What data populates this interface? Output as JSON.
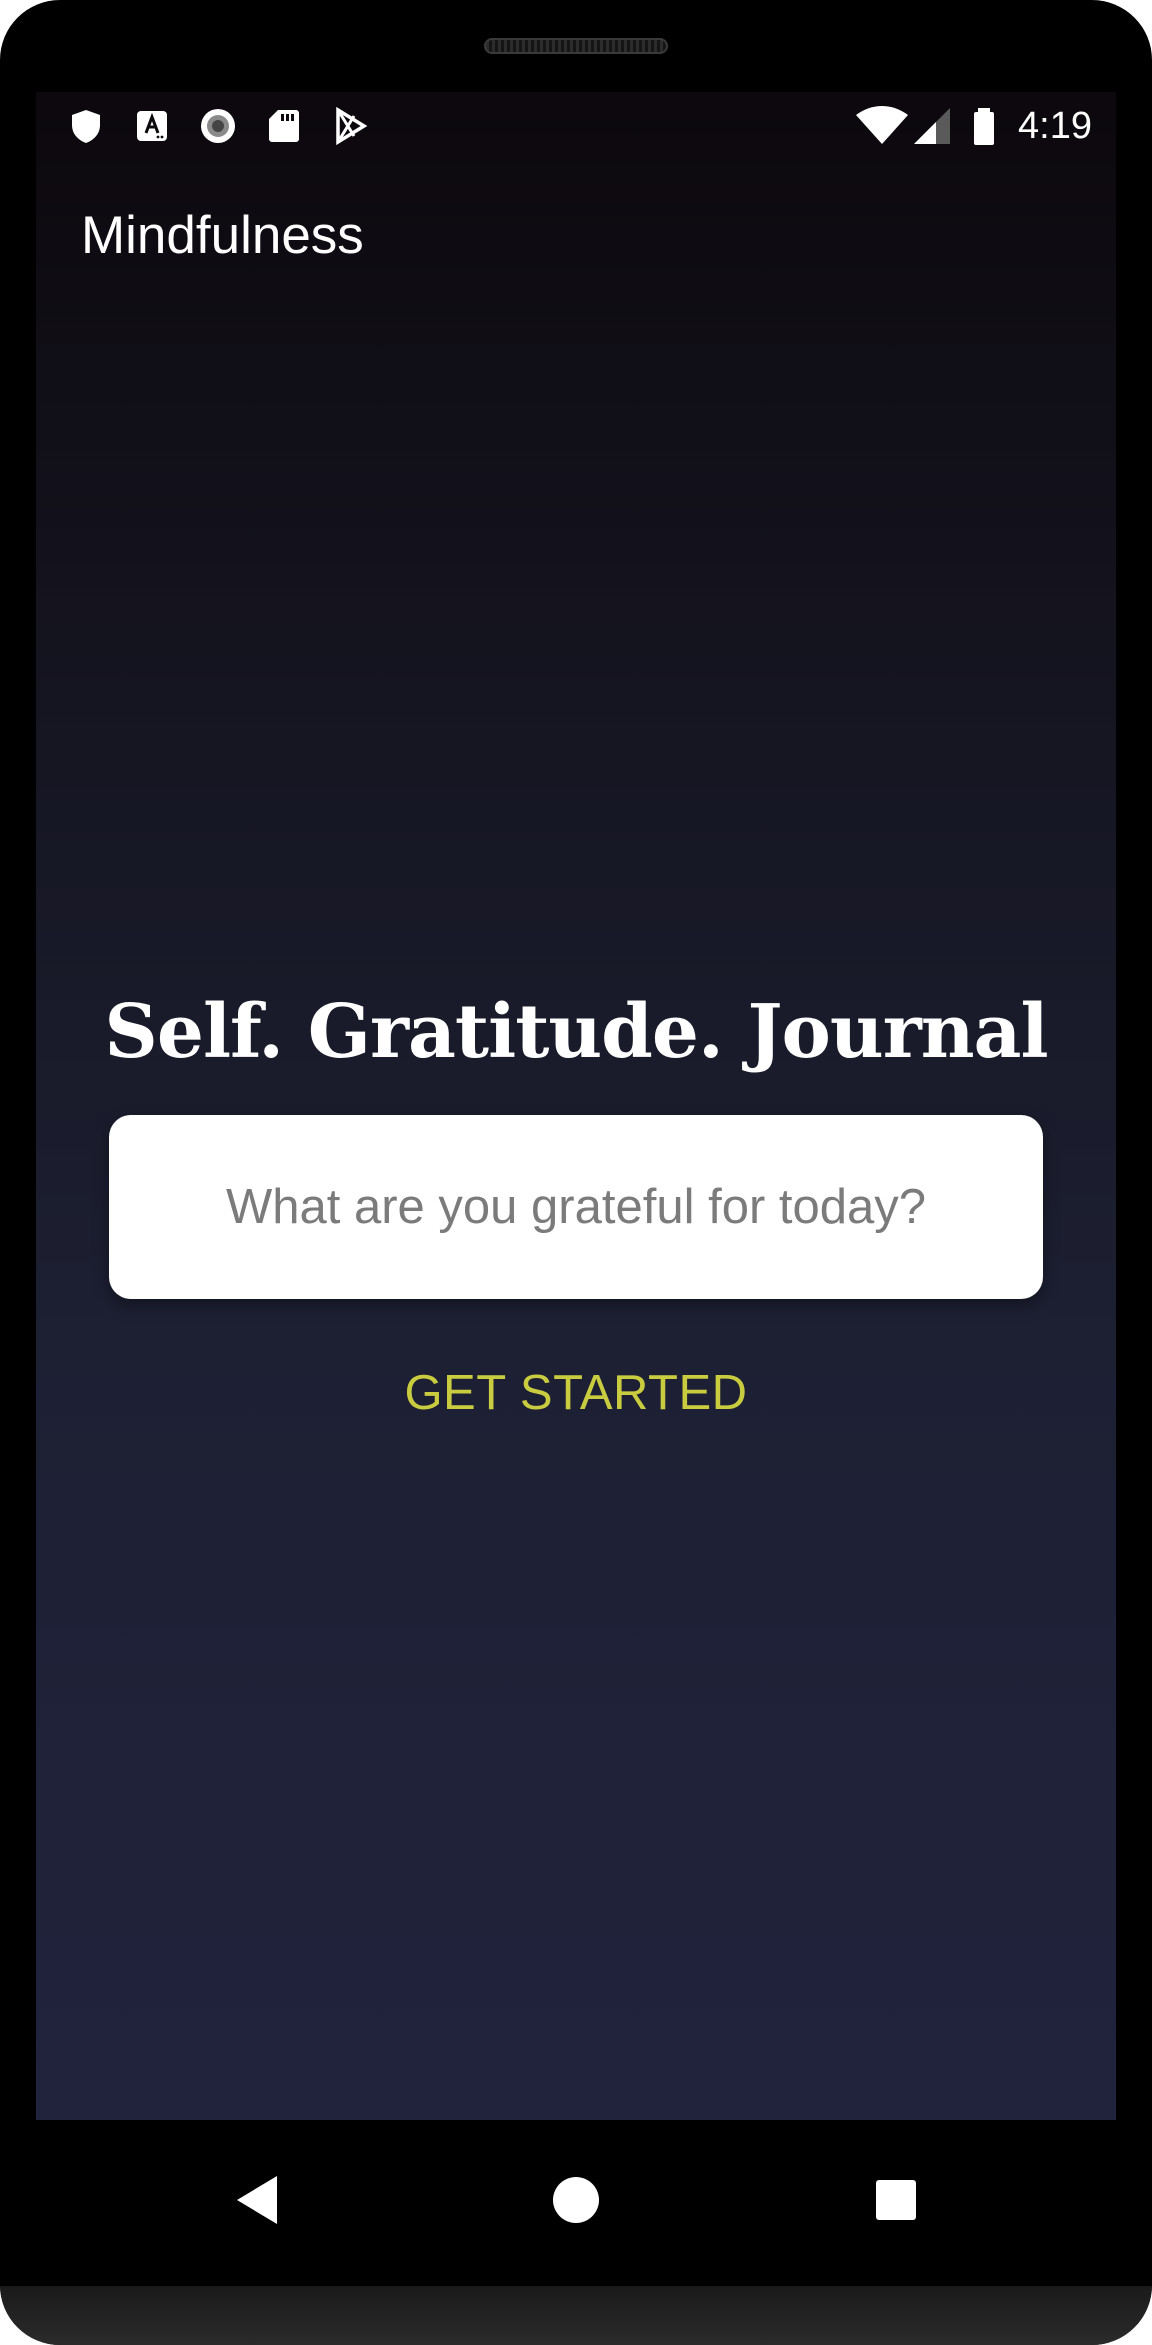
{
  "status_bar": {
    "time": "4:19",
    "left_icons": [
      "shield-icon",
      "font-download-icon",
      "record-icon",
      "sd-card-icon",
      "play-store-icon"
    ],
    "right_icons": [
      "wifi-icon",
      "cellular-signal-icon",
      "battery-icon"
    ]
  },
  "app_bar": {
    "title": "Mindfulness"
  },
  "main": {
    "headline": "Self. Gratitude. Journal",
    "gratitude_input": {
      "placeholder": "What are you grateful for today?",
      "value": ""
    },
    "get_started_label": "GET STARTED"
  },
  "nav_bar": {
    "buttons": [
      "back-icon",
      "home-icon",
      "recents-icon"
    ]
  },
  "colors": {
    "screen_top": "#0c080d",
    "screen_bottom": "#21233d",
    "accent": "#c9cc3f",
    "text_primary": "#ffffff",
    "placeholder": "#7b7b7b"
  }
}
